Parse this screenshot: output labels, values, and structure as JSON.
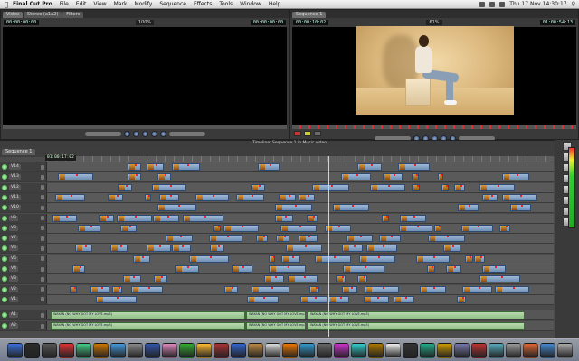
{
  "menubar": {
    "app_name": "Final Cut Pro",
    "items": [
      "File",
      "Edit",
      "View",
      "Mark",
      "Modify",
      "Sequence",
      "Effects",
      "Tools",
      "Window",
      "Help"
    ],
    "clock": "Thu 17 Nov 14:30:17"
  },
  "viewer": {
    "tabs": [
      "Video",
      "Stereo (a1a2)",
      "Filters"
    ],
    "timecode_left": "00:00:00:00",
    "timecode_right": "00:00:00:00",
    "zoom": "100%"
  },
  "canvas": {
    "tab": "Sequence 1",
    "timecode_left": "00:00:10:02",
    "timecode_right": "01:00:54:13",
    "zoom": "61%"
  },
  "timeline": {
    "title": "Timeline: Sequence 1 in Music video",
    "sequence_tab": "Sequence 1",
    "timecode": "01:00:17:02",
    "video_tracks": [
      "V14",
      "V13",
      "V12",
      "V11",
      "V10",
      "V9",
      "V8",
      "V7",
      "V6",
      "V5",
      "V4",
      "V3",
      "V2",
      "V1"
    ],
    "audio_tracks": [
      "A1",
      "A2"
    ],
    "audio_clip_label": "WAYAN (NO WHY GOT MY LOVE.mp3)"
  },
  "colors": {
    "clip_video": "#7f9fc4",
    "clip_audio": "#a8cc9e",
    "playhead": "#e9d97a"
  }
}
